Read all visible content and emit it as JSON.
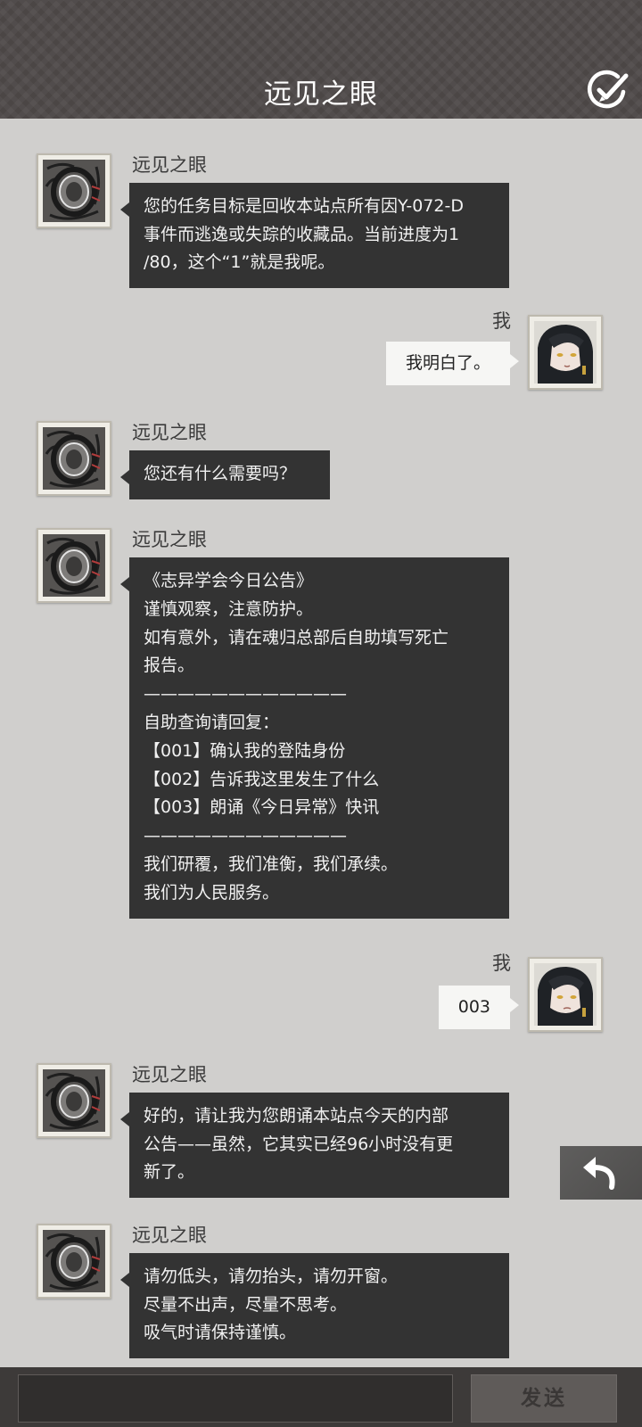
{
  "header": {
    "title": "远见之眼",
    "edit_icon": "edit-note-icon"
  },
  "names": {
    "bot": "远见之眼",
    "me": "我"
  },
  "messages": [
    {
      "from": "bot",
      "text": "您的任务目标是回收本站点所有因Y-072-D\n事件而逃逸或失踪的收藏品。当前进度为1\n/80，这个“1”就是我呢。"
    },
    {
      "from": "me",
      "text": "我明白了。"
    },
    {
      "from": "bot",
      "text": "您还有什么需要吗？"
    },
    {
      "from": "bot",
      "text": "《志异学会今日公告》\n谨慎观察，注意防护。\n如有意外，请在魂归总部后自助填写死亡\n报告。\n————————————\n自助查询请回复：\n【001】确认我的登陆身份\n【002】告诉我这里发生了什么\n【003】朗诵《今日异常》快讯\n————————————\n我们研覆，我们准衡，我们承续。\n我们为人民服务。"
    },
    {
      "from": "me",
      "text": "003"
    },
    {
      "from": "bot",
      "text": "好的，请让我为您朗诵本站点今天的内部\n公告——虽然，它其实已经96小时没有更\n新了。"
    },
    {
      "from": "bot",
      "text": "请勿低头，请勿抬头，请勿开窗。\n尽量不出声，尽量不思考。\n吸气时请保持谨慎。"
    }
  ],
  "footer": {
    "input_value": "",
    "send_label": "发送"
  },
  "colors": {
    "header_bg": "#4b4645",
    "chat_bg": "#d0cfcd",
    "bot_bubble": "#333333",
    "me_bubble": "#f6f6f4"
  }
}
